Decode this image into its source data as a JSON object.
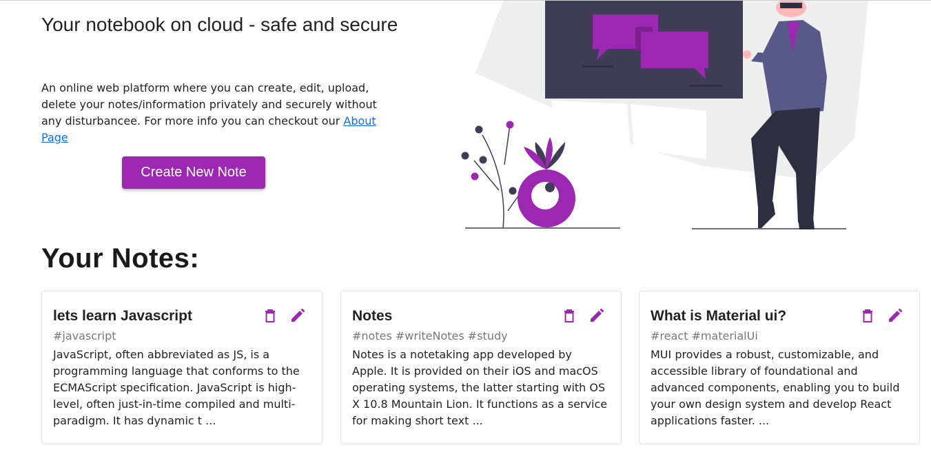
{
  "hero": {
    "title": "Your notebook on cloud - safe and secure",
    "description": "An online web platform where you can create, edit, upload, delete your notes/information privately and securely without any disturbancee. For more info you can checkout our ",
    "about_link": "About Page",
    "create_button": "Create New Note"
  },
  "notes_section": {
    "title": "Your Notes:",
    "notes": [
      {
        "title": "lets learn Javascript",
        "tags": "#javascript",
        "body": "JavaScript, often abbreviated as JS, is a programming language that conforms to the ECMAScript specification. JavaScript is high-level, often just-in-time compiled and multi-paradigm. It has dynamic t ..."
      },
      {
        "title": "Notes",
        "tags": "#notes #writeNotes #study",
        "body": "Notes is a notetaking app developed by Apple. It is provided on their iOS and macOS operating systems, the latter starting with OS X 10.8 Mountain Lion. It functions as a service for making short text ..."
      },
      {
        "title": "What is Material ui?",
        "tags": "#react #materialUi",
        "body": "MUI provides a robust, customizable, and accessible library of foundational and advanced components, enabling you to build your own design system and develop React applications faster. ..."
      }
    ]
  },
  "icons": {
    "delete": "trash-icon",
    "edit": "pencil-icon"
  },
  "colors": {
    "accent": "#9c27b0",
    "link": "#0d6efd",
    "dark": "#3f3d56"
  }
}
